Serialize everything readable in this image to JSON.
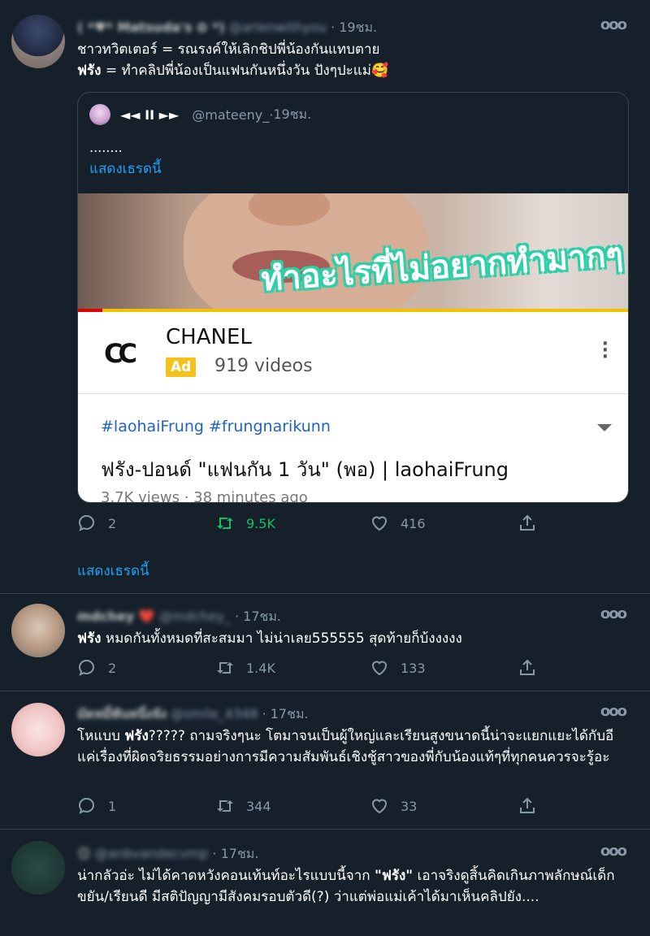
{
  "tweets": [
    {
      "display_name": "( *♥* Matsuda's ✿ *)",
      "handle": "@arlenwithyou",
      "time": "19ชม.",
      "line1": "ชาวทวิตเตอร์ = รณรงค์ให้เลิกชิปพี่น้องกันแทบตาย",
      "line2_bold": "ฟรัง",
      "line2_rest": " = ทำคลิปพี่น้องเป็นแฟนกันหนึ่งวัน ปังๆปะแม่🥰",
      "quote": {
        "name": "◄◄ II ►►",
        "handle": "@mateeny_",
        "time": "19ชม.",
        "text": "........",
        "show_thread": "แสดงเธรดนี้",
        "video_overlay": "ทำอะไรที่ไม่อยากทำมากๆ",
        "ad_logo": "CC",
        "ad_channel": "CHANEL",
        "ad_badge": "Ad",
        "ad_videos": "919 videos",
        "hashtags": "#laohaiFrung #frungnarikunn",
        "video_title": "ฟรัง-ปอนด์ \"แฟนกัน 1 วัน\" (พอ) | laohaiFrung",
        "video_meta": "3.7K views · 38 minutes ago"
      },
      "replies": "2",
      "retweets": "9.5K",
      "likes": "416",
      "show_thread": "แสดงเธรดนี้"
    },
    {
      "display_name": "mdchey ❤️",
      "handle": "@mdchey_",
      "time": "17ชม.",
      "text_bold": "ฟรัง",
      "text_rest": " หมดกันทั้งหมดที่สะสมมา ไม่น่าเลย555555 สุดท้ายก็บ้งงงงง",
      "replies": "2",
      "retweets": "1.4K",
      "likes": "133"
    },
    {
      "display_name": "มัดหมี่พันหนึ่งจัง",
      "handle": "@smile_4348",
      "time": "17ชม.",
      "text_start": "โหแบบ ",
      "text_bold": "ฟรัง",
      "text_rest": "????? ถามจริงๆนะ โตมาจนเป็นผู้ใหญ่และเรียนสูงขนาดนี้น่าจะแยกแยะได้กับอีแค่เรื่องที่ผิดจริยธรรมอย่างการมีความสัมพันธ์เชิงชู้สาวของพี่กับน้องแท้ๆที่ทุกคนควรจะรู้อะ",
      "replies": "1",
      "retweets": "344",
      "likes": "33"
    },
    {
      "display_name": "😊",
      "handle": "@anbvandecvmp",
      "time": "17ชม.",
      "text_start": "น่ากลัวอ่ะ ไม่ได้คาดหวังคอนเท้นท์อะไรแบบนี้จาก ",
      "text_bold": "\"ฟรัง\"",
      "text_rest": " เอาจริงดูสิ้นคิดเกินภาพลักษณ์เด็กขยัน/เรียนดี มีสติปัญญามีสังคมรอบตัวดี(?) ว่าแต่พ่อแม่เค้าได้มาเห็นคลิปยัง....",
      "more": "ooo"
    }
  ],
  "more_glyph": "ooo",
  "colors": {
    "background": "#15202b",
    "accent": "#1da1f2",
    "retweet_active": "#17bf63",
    "muted": "#8899a6"
  }
}
